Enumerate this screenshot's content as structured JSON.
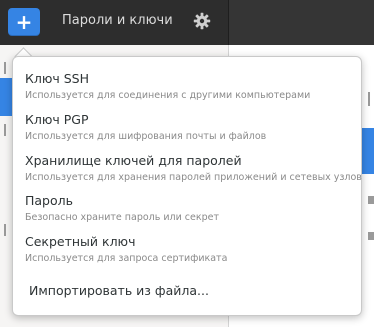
{
  "header": {
    "add_label": "+",
    "title": "Пароли и ключи",
    "settings_icon": "gear-icon"
  },
  "menu": {
    "items": [
      {
        "title": "Ключ SSH",
        "subtitle": "Используется для соединения с другими компьютерами"
      },
      {
        "title": "Ключ PGP",
        "subtitle": "Используется для шифрования почты и файлов"
      },
      {
        "title": "Хранилище ключей для паролей",
        "subtitle": "Используется для хранения паролей приложений и сетевых узлов"
      },
      {
        "title": "Пароль",
        "subtitle": "Безопасно храните пароль или секрет"
      },
      {
        "title": "Секретный ключ",
        "subtitle": "Используется для запроса сертификата"
      }
    ],
    "import_label": "Импортировать из файла..."
  },
  "colors": {
    "accent": "#3584e4",
    "header_bg": "#2d2d2d"
  }
}
